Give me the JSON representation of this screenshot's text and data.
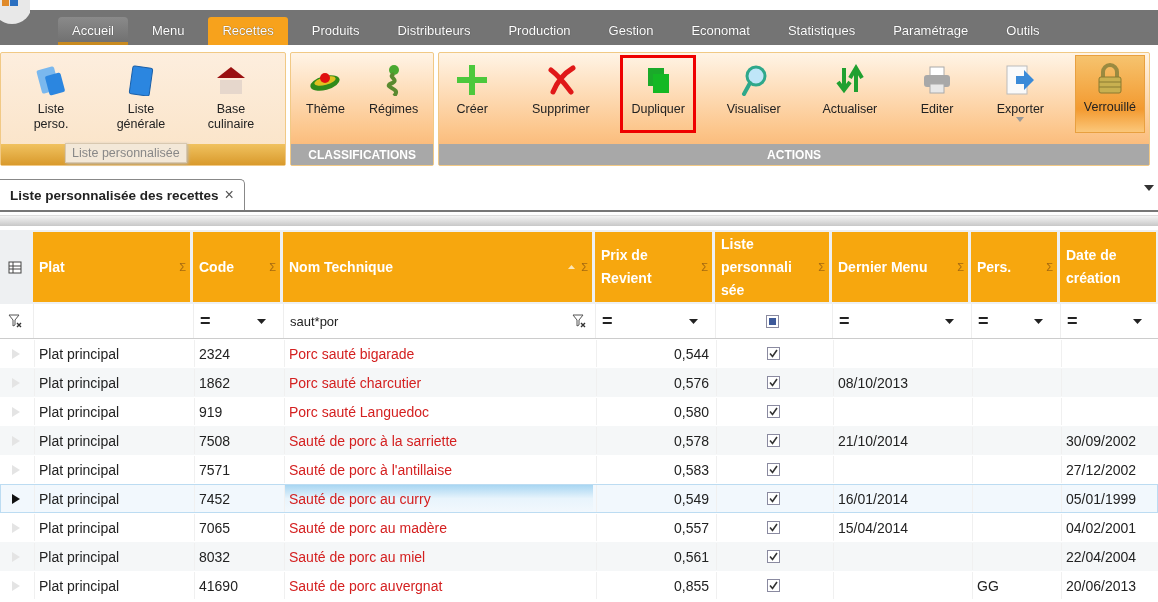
{
  "app_tabs": [
    {
      "label": "Accueil",
      "selected": false,
      "kind": "home"
    },
    {
      "label": "Menu",
      "selected": false
    },
    {
      "label": "Recettes",
      "selected": true
    },
    {
      "label": "Produits",
      "selected": false
    },
    {
      "label": "Distributeurs",
      "selected": false
    },
    {
      "label": "Production",
      "selected": false
    },
    {
      "label": "Gestion",
      "selected": false
    },
    {
      "label": "Economat",
      "selected": false
    },
    {
      "label": "Statistiques",
      "selected": false
    },
    {
      "label": "Paramétrage",
      "selected": false
    },
    {
      "label": "Outils",
      "selected": false
    }
  ],
  "ribbon": {
    "groups": [
      {
        "active": true,
        "items": [
          {
            "label": "Liste perso.",
            "kind": "cards"
          },
          {
            "label": "Liste générale",
            "kind": "card"
          },
          {
            "label": "Base culinaire",
            "kind": "house"
          }
        ]
      },
      {
        "title": "CLASSIFICATIONS",
        "active": false,
        "items": [
          {
            "label": "Thème",
            "kind": "dish"
          },
          {
            "label": "Régimes",
            "kind": "plant"
          }
        ]
      },
      {
        "title": "ACTIONS",
        "active": false,
        "items": [
          {
            "label": "Créer",
            "kind": "plus"
          },
          {
            "label": "Supprimer",
            "kind": "cross"
          },
          {
            "label": "Dupliquer",
            "kind": "copy",
            "highlighted": true
          },
          {
            "label": "Visualiser",
            "kind": "magnifier"
          },
          {
            "label": "Actualiser",
            "kind": "arrows"
          },
          {
            "label": "Editer",
            "kind": "printer"
          },
          {
            "label": "Exporter",
            "kind": "export",
            "dropdown": true
          },
          {
            "label": "Verrouillé",
            "kind": "padlock",
            "pressed": true
          }
        ]
      }
    ]
  },
  "tooltip": {
    "text": "Liste personnalisée"
  },
  "document_tabs": [
    {
      "label": "Liste personnalisée des recettes",
      "selected": true,
      "close": "×"
    }
  ],
  "grid": {
    "columns": [
      {
        "title": "Plat",
        "sigma": "Σ",
        "filter": {
          "kind": "none"
        }
      },
      {
        "title": "Code",
        "sigma": "Σ",
        "filter": {
          "kind": "operator",
          "operator": "="
        }
      },
      {
        "title": "Nom Technique",
        "sigma": "Σ",
        "sorted": true,
        "filter": {
          "kind": "text",
          "value": "saut*por"
        }
      },
      {
        "title": "Prix de Revient",
        "sigma": "Σ",
        "filter": {
          "kind": "operator",
          "operator": "="
        }
      },
      {
        "title": "Liste personnali sée",
        "sigma": "Σ",
        "filter": {
          "kind": "checkbox",
          "indeterminate": true
        }
      },
      {
        "title": "Dernier Menu",
        "sigma": "Σ",
        "filter": {
          "kind": "operator",
          "operator": "="
        }
      },
      {
        "title": "Pers.",
        "sigma": "Σ",
        "filter": {
          "kind": "operator",
          "operator": "="
        }
      },
      {
        "title": "Date de création",
        "filter": {
          "kind": "operator",
          "operator": "="
        }
      }
    ],
    "rows": [
      {
        "selected": false,
        "plat": "Plat principal",
        "code": "2324",
        "nom": "Porc sauté bigarade",
        "prix": "0,544",
        "liste": true
      },
      {
        "selected": false,
        "plat": "Plat principal",
        "code": "1862",
        "nom": "Porc sauté charcutier",
        "prix": "0,576",
        "liste": true,
        "dernier_menu": "08/10/2013"
      },
      {
        "selected": false,
        "plat": "Plat principal",
        "code": "919",
        "nom": "Porc sauté Languedoc",
        "prix": "0,580",
        "liste": true
      },
      {
        "selected": false,
        "plat": "Plat principal",
        "code": "7508",
        "nom": "Sauté de porc à la sarriette",
        "prix": "0,578",
        "liste": true,
        "dernier_menu": "21/10/2014",
        "date": "30/09/2002"
      },
      {
        "selected": false,
        "plat": "Plat principal",
        "code": "7571",
        "nom": "Sauté de porc à l'antillaise",
        "prix": "0,583",
        "liste": true,
        "date": "27/12/2002"
      },
      {
        "selected": true,
        "plat": "Plat principal",
        "code": "7452",
        "nom": "Sauté de porc au curry",
        "prix": "0,549",
        "liste": true,
        "dernier_menu": "16/01/2014",
        "date": "05/01/1999"
      },
      {
        "selected": false,
        "plat": "Plat principal",
        "code": "7065",
        "nom": "Sauté de porc au madère",
        "prix": "0,557",
        "liste": true,
        "dernier_menu": "15/04/2014",
        "date": "04/02/2001"
      },
      {
        "selected": false,
        "plat": "Plat principal",
        "code": "8032",
        "nom": "Sauté de porc au miel",
        "prix": "0,561",
        "liste": true,
        "date": "22/04/2004"
      },
      {
        "selected": false,
        "plat": "Plat principal",
        "code": "41690",
        "nom": "Sauté de porc auvergnat",
        "prix": "0,855",
        "liste": true,
        "pers": "GG",
        "date": "20/06/2013"
      }
    ]
  }
}
